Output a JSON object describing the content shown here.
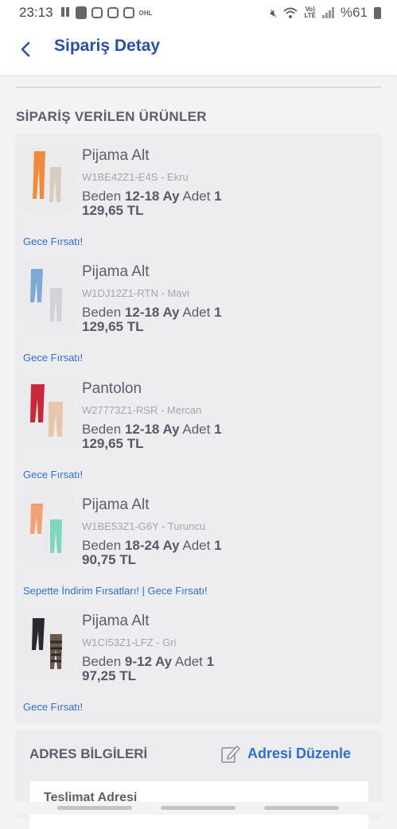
{
  "status_bar": {
    "time": "23:13",
    "battery_text": "%61",
    "network_label_top": "Vo)",
    "network_label_bottom": "LTE",
    "app_badge": "OHL"
  },
  "header": {
    "title": "Sipariş Detay"
  },
  "section_title": "SİPARİŞ VERİLEN ÜRÜNLER",
  "products": [
    {
      "name": "Pijama Alt",
      "sku": "W1BE42Z1-E4S - Ekru",
      "size_label": "Beden",
      "size": "12-18 Ay",
      "qty_label": "Adet",
      "qty": "1",
      "price": "129,65 TL",
      "campaign": "Gece Fırsatı!"
    },
    {
      "name": "Pijama Alt",
      "sku": "W1DJ12Z1-RTN - Mavi",
      "size_label": "Beden",
      "size": "12-18 Ay",
      "qty_label": "Adet",
      "qty": "1",
      "price": "129,65 TL",
      "campaign": "Gece Fırsatı!"
    },
    {
      "name": "Pantolon",
      "sku": "W27773Z1-RSR - Mercan",
      "size_label": "Beden",
      "size": "12-18 Ay",
      "qty_label": "Adet",
      "qty": "1",
      "price": "129,65 TL",
      "campaign": "Gece Fırsatı!"
    },
    {
      "name": "Pijama Alt",
      "sku": "W1BE53Z1-G6Y - Turuncu",
      "size_label": "Beden",
      "size": "18-24 Ay",
      "qty_label": "Adet",
      "qty": "1",
      "price": "90,75 TL",
      "campaign": "Sepette İndirim Fırsatları! | Gece Fırsatı!"
    },
    {
      "name": "Pijama Alt",
      "sku": "W1CI53Z1-LFZ - Gri",
      "size_label": "Beden",
      "size": "9-12 Ay",
      "qty_label": "Adet",
      "qty": "1",
      "price": "97,25 TL",
      "campaign": "Gece Fırsatı!"
    }
  ],
  "address": {
    "title": "ADRES BİLGİLERİ",
    "edit_label": "Adresi Düzenle",
    "delivery_title": "Teslimat Adresi"
  },
  "colors": {
    "accent": "#2b4fa8",
    "link": "#2e6fd6"
  },
  "product_images": [
    {
      "icon": "pants-orange-beige-icon",
      "c1": "#f28a3c",
      "c2": "#d6cdbd"
    },
    {
      "icon": "pants-blue-grey-icon",
      "c1": "#7ea9d6",
      "c2": "#cfd3d6"
    },
    {
      "icon": "pants-red-beige-icon",
      "c1": "#c8283a",
      "c2": "#e6c7ab"
    },
    {
      "icon": "pants-orange-mint-icon",
      "c1": "#f5a070",
      "c2": "#7fd6c0"
    },
    {
      "icon": "pants-black-striped-icon",
      "c1": "#2a2a2e",
      "c2": "#6b5a4a"
    }
  ]
}
